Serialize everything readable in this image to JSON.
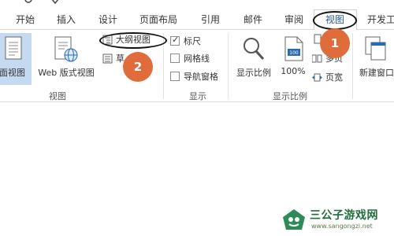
{
  "tabs": [
    {
      "label": "开始"
    },
    {
      "label": "插入"
    },
    {
      "label": "设计"
    },
    {
      "label": "页面布局"
    },
    {
      "label": "引用"
    },
    {
      "label": "邮件"
    },
    {
      "label": "审阅"
    },
    {
      "label": "视图"
    },
    {
      "label": "开发工"
    }
  ],
  "active_tab": "视图",
  "view_group": {
    "print_layout": "页面视图",
    "web_layout": "Web 版式视图",
    "outline": "大纲视图",
    "draft": "草",
    "label": "视图"
  },
  "show_group": {
    "ruler": "标尺",
    "gridlines": "网格线",
    "nav_pane": "导航窗格",
    "label": "显示",
    "ruler_checked": true,
    "gridlines_checked": false,
    "nav_pane_checked": false
  },
  "zoom_group": {
    "zoom": "显示比例",
    "hundred": "100%",
    "multi_page": "多页",
    "page_width": "页宽",
    "label": "显示比例"
  },
  "window_group": {
    "new_window": "新建窗口"
  },
  "annotations": {
    "step1": "1",
    "step2": "2"
  },
  "watermark": {
    "title": "三公子游戏网",
    "url": "www.sangongzi.net"
  },
  "colors": {
    "accent": "#2b579a",
    "badge": "#e06c3c",
    "selected": "#c5d9f1"
  }
}
